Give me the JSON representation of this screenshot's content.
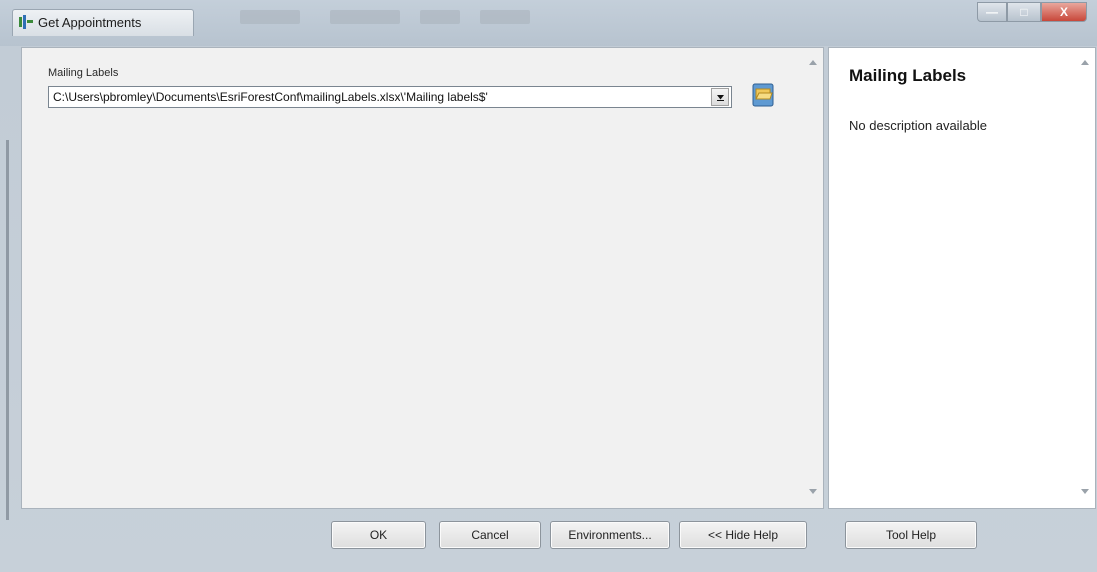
{
  "window": {
    "title": "Get Appointments",
    "controls": {
      "minimize": "—",
      "maximize": "□",
      "close": "X"
    }
  },
  "form": {
    "field_label": "Mailing Labels",
    "path_value": "C:\\Users\\pbromley\\Documents\\EsriForestConf\\mailingLabels.xlsx\\'Mailing labels$'"
  },
  "help": {
    "title": "Mailing Labels",
    "description": "No description available"
  },
  "buttons": {
    "ok": "OK",
    "cancel": "Cancel",
    "environments": "Environments...",
    "hide_help": "<< Hide Help",
    "tool_help": "Tool Help"
  },
  "icons": {
    "app": "toolbox-icon",
    "dropdown": "chevron-down-icon",
    "browse": "open-folder-icon"
  },
  "colors": {
    "close_button": "#c8473a",
    "panel_bg": "#f1f1f1",
    "help_bg": "#ffffff"
  }
}
